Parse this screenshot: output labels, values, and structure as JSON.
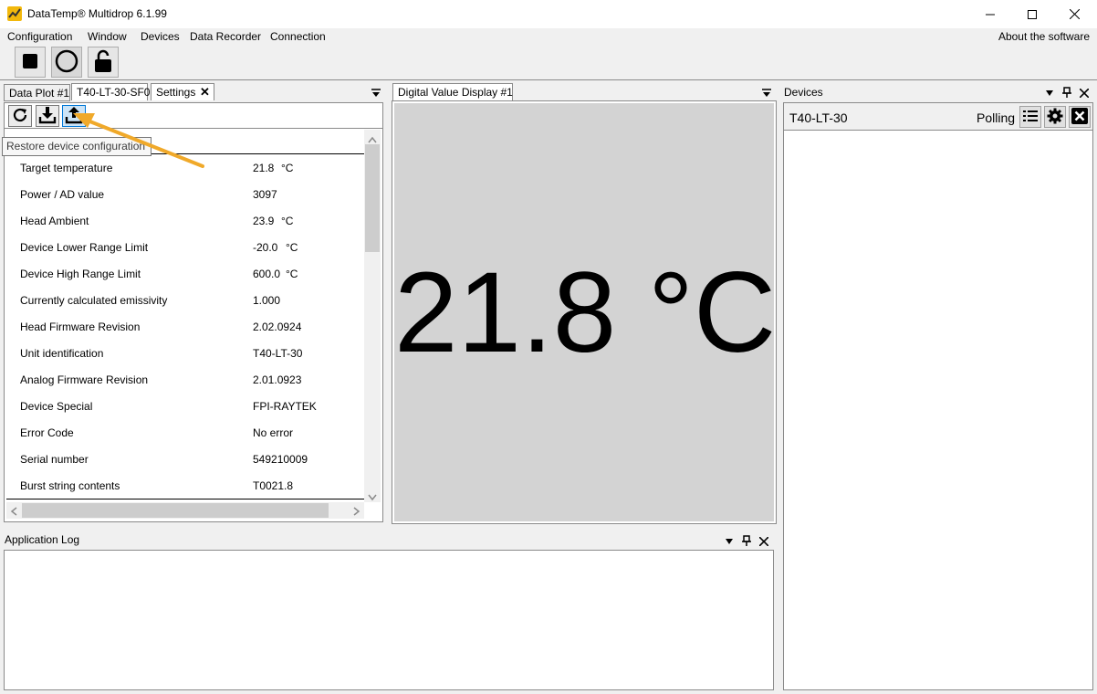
{
  "window": {
    "title": "DataTemp® Multidrop 6.1.99"
  },
  "menu": {
    "items": [
      "Configuration",
      "Window",
      "Devices",
      "Data Recorder",
      "Connection"
    ],
    "about": "About the software"
  },
  "toolbar": {
    "icons": [
      "stop-icon",
      "circle-icon",
      "unlock-icon"
    ]
  },
  "left_panel": {
    "tabs": [
      {
        "label": "Data Plot #1"
      },
      {
        "label": "T40-LT-30-SF0"
      },
      {
        "label": "Settings"
      }
    ],
    "close_glyph": "✕",
    "tooltip": "Restore device configuration",
    "rows": [
      {
        "label": "Target temperature",
        "value": "21.8",
        "unit": "°C"
      },
      {
        "label": "Power / AD value",
        "value": "3097",
        "unit": ""
      },
      {
        "label": "Head Ambient",
        "value": "23.9",
        "unit": "°C"
      },
      {
        "label": "Device Lower Range Limit",
        "value": "-20.0",
        "unit": "°C"
      },
      {
        "label": "Device High Range Limit",
        "value": "600.0",
        "unit": "°C"
      },
      {
        "label": "Currently calculated emissivity",
        "value": "1.000",
        "unit": ""
      },
      {
        "label": "Head Firmware Revision",
        "value": "2.02.0924",
        "unit": ""
      },
      {
        "label": "Unit identification",
        "value": "T40-LT-30",
        "unit": ""
      },
      {
        "label": "Analog Firmware Revision",
        "value": "2.01.0923",
        "unit": ""
      },
      {
        "label": "Device Special",
        "value": "FPI-RAYTEK",
        "unit": ""
      },
      {
        "label": "Error Code",
        "value": "No error",
        "unit": ""
      },
      {
        "label": "Serial number",
        "value": "549210009",
        "unit": ""
      },
      {
        "label": "Burst string contents",
        "value": "T0021.8",
        "unit": ""
      }
    ]
  },
  "digital_panel": {
    "tab": "Digital Value Display #1",
    "value": "21.8 °C"
  },
  "devices_panel": {
    "title": "Devices",
    "device_name": "T40-LT-30",
    "status": "Polling"
  },
  "log_panel": {
    "title": "Application Log"
  },
  "colors": {
    "accent_arrow": "#f0a92a",
    "display_bg": "#d3d3d3",
    "app_icon": "#f2b80c"
  }
}
